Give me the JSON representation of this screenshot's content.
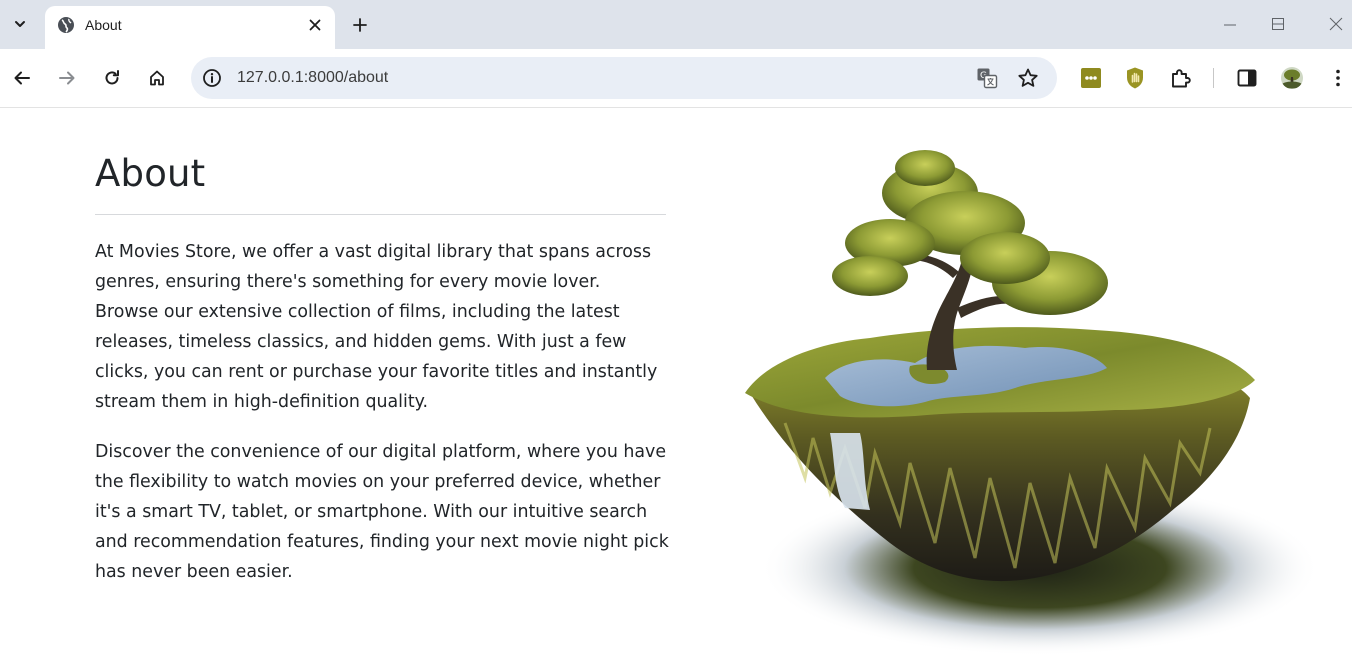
{
  "browser": {
    "tab": {
      "title": "About"
    },
    "address": {
      "url": "127.0.0.1:8000/about"
    }
  },
  "page": {
    "heading": "About",
    "paragraphs": [
      "At Movies Store, we offer a vast digital library that spans across genres, ensuring there's something for every movie lover. Browse our extensive collection of films, including the latest releases, timeless classics, and hidden gems. With just a few clicks, you can rent or purchase your favorite titles and instantly stream them in high-definition quality.",
      "Discover the convenience of our digital platform, where you have the flexibility to watch movies on your preferred device, whether it's a smart TV, tablet, or smartphone. With our intuitive search and recommendation features, finding your next movie night pick has never been easier."
    ]
  },
  "colors": {
    "tabstrip": "#dee3eb",
    "omnibox": "#e9eef6",
    "text": "#212529",
    "extension_accent": "#8f8a1f"
  },
  "icons": [
    "chevron-down-icon",
    "globe-icon",
    "close-icon",
    "plus-icon",
    "minimize-icon",
    "maximize-icon",
    "window-close-icon",
    "back-arrow-icon",
    "forward-arrow-icon",
    "reload-icon",
    "home-icon",
    "info-icon",
    "translate-icon",
    "star-icon",
    "extension-dots-icon",
    "extension-hand-icon",
    "puzzle-icon",
    "sidepanel-icon",
    "profile-avatar-icon",
    "kebab-menu-icon",
    "floating-island-illustration"
  ]
}
